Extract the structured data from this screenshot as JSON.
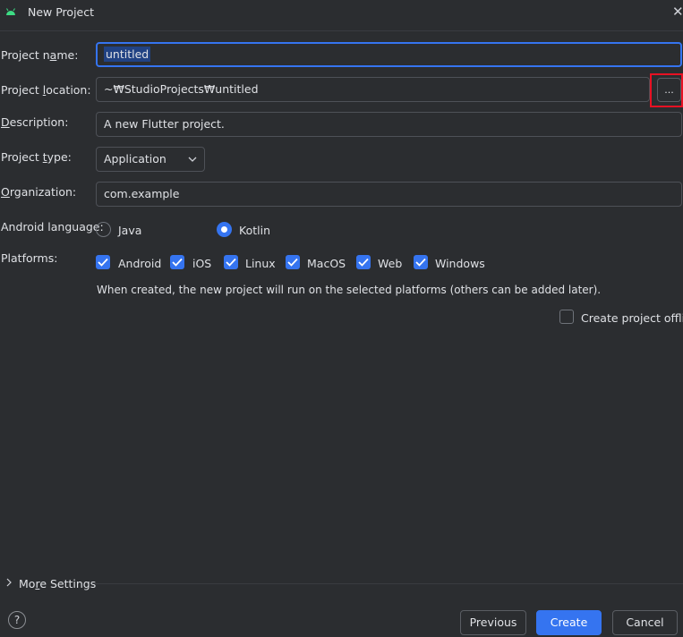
{
  "window": {
    "title": "New Project",
    "close": "✕"
  },
  "fields": {
    "project_name": {
      "label": "Project name:",
      "value": "untitled"
    },
    "project_location": {
      "label": "Project location:",
      "value": "~₩StudioProjects₩untitled",
      "browse_label": "..."
    },
    "description": {
      "label": "Description:",
      "value": "A new Flutter project."
    },
    "project_type": {
      "label": "Project type:",
      "value": "Application"
    },
    "organization": {
      "label": "Organization:",
      "value": "com.example"
    }
  },
  "android_language": {
    "label": "Android language:",
    "options": [
      {
        "label": "Java",
        "selected": false
      },
      {
        "label": "Kotlin",
        "selected": true
      }
    ]
  },
  "platforms": {
    "label": "Platforms:",
    "items": [
      {
        "label": "Android",
        "checked": true
      },
      {
        "label": "iOS",
        "checked": true
      },
      {
        "label": "Linux",
        "checked": true
      },
      {
        "label": "MacOS",
        "checked": true
      },
      {
        "label": "Web",
        "checked": true
      },
      {
        "label": "Windows",
        "checked": true
      }
    ],
    "note": "When created, the new project will run on the selected platforms (others can be added later)."
  },
  "offline": {
    "label": "Create project offline",
    "checked": false
  },
  "more_settings": {
    "label": "More Settings"
  },
  "footer": {
    "help": "?",
    "previous": "Previous",
    "create": "Create",
    "cancel": "Cancel"
  },
  "colors": {
    "accent": "#3574f0",
    "background": "#2b2d30",
    "highlight_box": "#e81123"
  }
}
